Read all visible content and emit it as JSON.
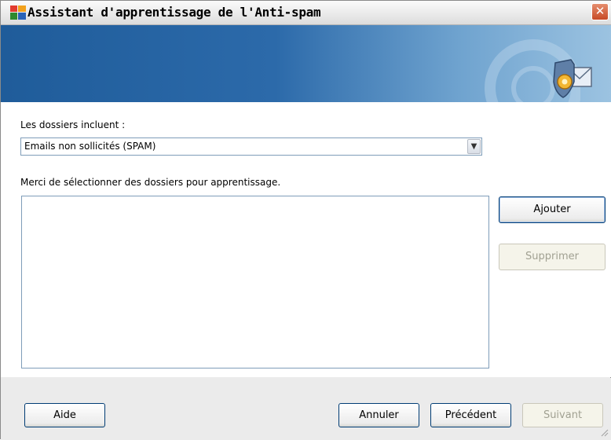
{
  "window": {
    "title": "Assistant d'apprentissage de l'Anti-spam",
    "close_glyph": "✕"
  },
  "form": {
    "folders_label": "Les dossiers incluent :",
    "folders_select_value": "Emails non sollicités (SPAM)",
    "select_instruction": "Merci de sélectionner des dossiers pour apprentissage."
  },
  "side_buttons": {
    "add_label": "Ajouter",
    "remove_label": "Supprimer"
  },
  "footer": {
    "help_label": "Aide",
    "cancel_label": "Annuler",
    "previous_label": "Précédent",
    "next_label": "Suivant"
  },
  "icons": {
    "app": "avg-app-icon",
    "banner": "shield-envelope-gear-icon",
    "dropdown": "chevron-down-icon"
  },
  "colors": {
    "banner_start": "#1f5c9a",
    "banner_end": "#9cc3e1",
    "close_button": "#c74a26"
  }
}
